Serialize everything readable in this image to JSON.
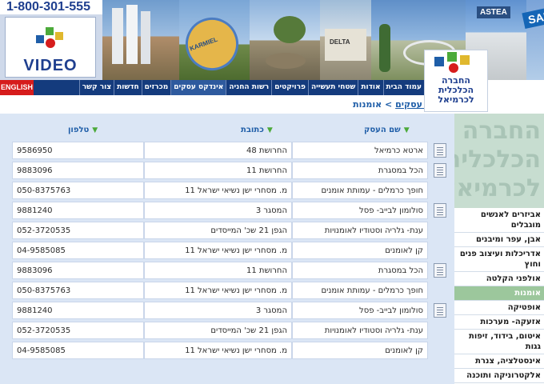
{
  "header": {
    "phone": "1-800-301-555",
    "video_label": "VIDEO",
    "english_button": "ENGLISH",
    "corp_logo_text": "החברה הכלכלית לכרמיאל",
    "photo_signs": [
      "KARMIEL",
      "DELTA",
      "ASTEA",
      "SAP"
    ]
  },
  "nav": [
    "עמוד הבית",
    "אודות",
    "שטחי תעשייה",
    "פרויקטים",
    "רשות החניה",
    "אינדקס עסקים",
    "מכרזים",
    "חדשות",
    "צור קשר"
  ],
  "breadcrumb": {
    "link": "אינדקס עסקים",
    "separator": ">",
    "current": "אומנות"
  },
  "table": {
    "headers": {
      "name": "שם העסק",
      "address": "כתובת",
      "phone": "טלפון"
    },
    "rows": [
      {
        "name": "ארטא כרמיאל",
        "address": "החרושת 48",
        "phone": "9586950",
        "icon": true
      },
      {
        "name": "הכל במסגרת",
        "address": "החרושת 11",
        "phone": "9883096",
        "icon": true
      },
      {
        "name": "חופך כרמלים - עמותת אומנים",
        "address": "מ. מסחרי ישן נשיאי ישראל 11",
        "phone": "050-8375763",
        "icon": false
      },
      {
        "name": "סולומון לבייב- פסל",
        "address": "המסגר 3",
        "phone": "9881240",
        "icon": true
      },
      {
        "name": "ענת- גלריה וסטודיו לאומנויות",
        "address": "הגפן 21 שכ' המייסדים",
        "phone": "052-3720535",
        "icon": false
      },
      {
        "name": "קן לאומנים",
        "address": "מ. מסחרי ישן נשיאי ישראל 11",
        "phone": "04-9585085",
        "icon": false
      },
      {
        "name": "הכל במסגרת",
        "address": "החרושת 11",
        "phone": "9883096",
        "icon": true
      },
      {
        "name": "חופך כרמלים - עמותת אומנים",
        "address": "מ. מסחרי ישן נשיאי ישראל 11",
        "phone": "050-8375763",
        "icon": false
      },
      {
        "name": "סולומון לבייב- פסל",
        "address": "המסגר 3",
        "phone": "9881240",
        "icon": true
      },
      {
        "name": "ענת- גלריה וסטודיו לאומנויות",
        "address": "הגפן 21 שכ' המייסדים",
        "phone": "052-3720535",
        "icon": false
      },
      {
        "name": "קן לאומנים",
        "address": "מ. מסחרי ישן נשיאי ישראל 11",
        "phone": "04-9585085",
        "icon": false
      }
    ]
  },
  "sidebar": {
    "logo_text": "החברה הכלכלית לכרמיאל",
    "items": [
      {
        "label": "אביזרים לאנשים מוגבלים",
        "active": false
      },
      {
        "label": "אבן, עפר ומיבנים",
        "active": false
      },
      {
        "label": "אדריכלות ועיצוב פנים וחוץ",
        "active": false
      },
      {
        "label": "אולפני הקלטה",
        "active": false
      },
      {
        "label": "אומנות",
        "active": true
      },
      {
        "label": "אופטיקה",
        "active": false
      },
      {
        "label": "אזעקה- מערכות",
        "active": false
      },
      {
        "label": "איטום, בידוד, זיפות גגות",
        "active": false
      },
      {
        "label": "אינסטלציה, צנרת",
        "active": false
      },
      {
        "label": "אלקטרוניקה ותוכנה",
        "active": false
      }
    ]
  },
  "colors": {
    "navbar": "#143b7d",
    "english": "#d61c1c",
    "content_bg": "#dbe6f5",
    "active_side": "#9cc79c",
    "link": "#1f5ea8"
  }
}
